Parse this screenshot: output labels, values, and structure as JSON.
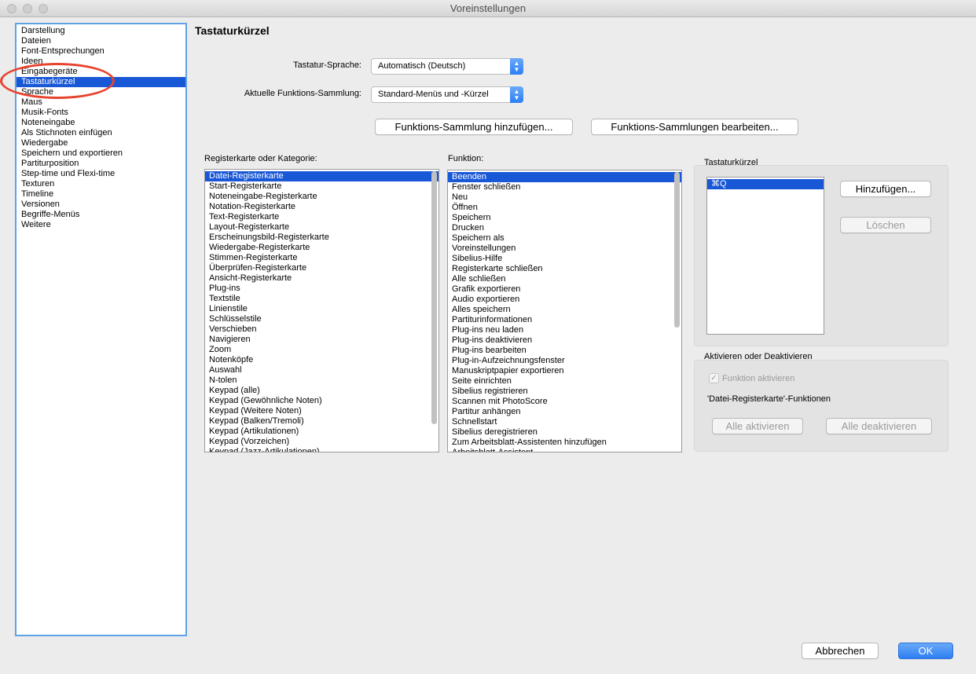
{
  "window": {
    "title": "Voreinstellungen"
  },
  "sidebar": {
    "items": [
      "Darstellung",
      "Dateien",
      "Font-Entsprechungen",
      "Ideen",
      "Eingabegeräte",
      "Tastaturkürzel",
      "Sprache",
      "Maus",
      "Musik-Fonts",
      "Noteneingabe",
      "Als Stichnoten einfügen",
      "Wiedergabe",
      "Speichern und exportieren",
      "Partiturposition",
      "Step-time und Flexi-time",
      "Texturen",
      "Timeline",
      "Versionen",
      "Begriffe-Menüs",
      "Weitere"
    ],
    "selected_index": 5
  },
  "main": {
    "title": "Tastaturkürzel",
    "language": {
      "label": "Tastatur-Sprache:",
      "value": "Automatisch (Deutsch)"
    },
    "collection": {
      "label": "Aktuelle Funktions-Sammlung:",
      "value": "Standard-Menüs und -Kürzel"
    },
    "add_collection_button": "Funktions-Sammlung hinzufügen...",
    "edit_collections_button": "Funktions-Sammlungen bearbeiten...",
    "category": {
      "label": "Registerkarte oder Kategorie:",
      "items": [
        "Datei-Registerkarte",
        "Start-Registerkarte",
        "Noteneingabe-Registerkarte",
        "Notation-Registerkarte",
        "Text-Registerkarte",
        "Layout-Registerkarte",
        "Erscheinungsbild-Registerkarte",
        "Wiedergabe-Registerkarte",
        "Stimmen-Registerkarte",
        "Überprüfen-Registerkarte",
        "Ansicht-Registerkarte",
        "Plug-ins",
        "Textstile",
        "Linienstile",
        "Schlüsselstile",
        "Verschieben",
        "Navigieren",
        "Zoom",
        "Notenköpfe",
        "Auswahl",
        "N-tolen",
        "Keypad (alle)",
        "Keypad (Gewöhnliche Noten)",
        "Keypad (Weitere Noten)",
        "Keypad (Balken/Tremoli)",
        "Keypad (Artikulationen)",
        "Keypad (Vorzeichen)",
        "Keypad (Jazz-Artikulationen)"
      ]
    },
    "function": {
      "label": "Funktion:",
      "items": [
        "Beenden",
        "Fenster schließen",
        "Neu",
        "Öffnen",
        "Speichern",
        "Drucken",
        "Speichern als",
        "Voreinstellungen",
        "Sibelius-Hilfe",
        "Registerkarte schließen",
        "Alle schließen",
        "Grafik exportieren",
        "Audio exportieren",
        "Alles speichern",
        "Partiturinformationen",
        "Plug-ins neu laden",
        "Plug-ins deaktivieren",
        "Plug-ins bearbeiten",
        "Plug-in-Aufzeichnungsfenster",
        "Manuskriptpapier exportieren",
        "Seite einrichten",
        "Sibelius registrieren",
        "Scannen mit PhotoScore",
        "Partitur anhängen",
        "Schnellstart",
        "Sibelius deregistrieren",
        "Zum Arbeitsblatt-Assistenten hinzufügen",
        "Arbeitsblatt-Assistent"
      ]
    },
    "shortcuts": {
      "group_label": "Tastaturkürzel",
      "items": [
        "⌘Q"
      ],
      "add_button": "Hinzufügen...",
      "delete_button": "Löschen"
    },
    "activation": {
      "group_label": "Aktivieren oder Deaktivieren",
      "checkbox_label": "Funktion aktivieren",
      "checkbox_mark": "✓",
      "info_text": "'Datei-Registerkarte'-Funktionen",
      "activate_all": "Alle aktivieren",
      "deactivate_all": "Alle deaktivieren"
    }
  },
  "footer": {
    "cancel_button": "Abbrechen",
    "ok_button": "OK"
  },
  "colors": {
    "selection": "#1857d6",
    "accent": "#2e7ff4",
    "annotation": "#e8432e"
  }
}
